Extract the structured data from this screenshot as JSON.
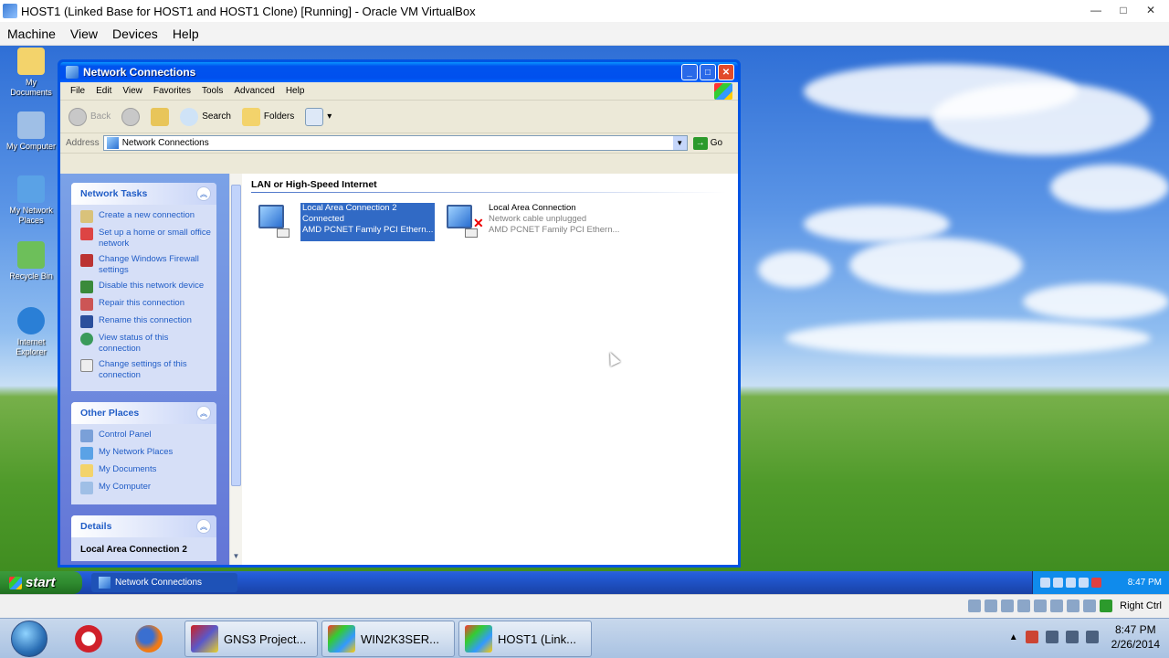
{
  "vbox": {
    "title": "HOST1 (Linked Base for HOST1 and HOST1 Clone) [Running] - Oracle VM VirtualBox",
    "menu": [
      "Machine",
      "View",
      "Devices",
      "Help"
    ],
    "status_right_text": "Right Ctrl"
  },
  "desktop": {
    "icons": [
      {
        "label": "My Documents",
        "icon": "folder-icon"
      },
      {
        "label": "My Computer",
        "icon": "computer-icon"
      },
      {
        "label": "My Network Places",
        "icon": "network-icon"
      },
      {
        "label": "Recycle Bin",
        "icon": "recycle-bin-icon"
      },
      {
        "label": "Internet Explorer",
        "icon": "ie-icon"
      }
    ]
  },
  "window": {
    "title": "Network Connections",
    "menu": [
      "File",
      "Edit",
      "View",
      "Favorites",
      "Tools",
      "Advanced",
      "Help"
    ],
    "toolbar": {
      "back": "Back",
      "search": "Search",
      "folders": "Folders"
    },
    "address": {
      "label": "Address",
      "value": "Network Connections",
      "go": "Go"
    },
    "taskpane": {
      "network_tasks": {
        "title": "Network Tasks",
        "items": [
          "Create a new connection",
          "Set up a home or small office network",
          "Change Windows Firewall settings",
          "Disable this network device",
          "Repair this connection",
          "Rename this connection",
          "View status of this connection",
          "Change settings of this connection"
        ]
      },
      "other_places": {
        "title": "Other Places",
        "items": [
          "Control Panel",
          "My Network Places",
          "My Documents",
          "My Computer"
        ]
      },
      "details": {
        "title": "Details",
        "name": "Local Area Connection 2"
      }
    },
    "content": {
      "group_header": "LAN or High-Speed Internet",
      "connections": [
        {
          "name": "Local Area Connection 2",
          "status": "Connected",
          "device": "AMD PCNET Family PCI Ethern...",
          "selected": true
        },
        {
          "name": "Local Area Connection",
          "status": "Network cable unplugged",
          "device": "AMD PCNET Family PCI Ethern...",
          "selected": false
        }
      ]
    }
  },
  "xp_taskbar": {
    "start": "start",
    "task": "Network Connections",
    "time": "8:47 PM"
  },
  "host_taskbar": {
    "buttons": [
      "GNS3 Project...",
      "WIN2K3SER...",
      "HOST1 (Link..."
    ],
    "time": "8:47 PM",
    "date": "2/26/2014"
  },
  "colors": {
    "xp_blue": "#0054e3",
    "taskpane_link": "#215dc6",
    "selection": "#316ac5"
  }
}
